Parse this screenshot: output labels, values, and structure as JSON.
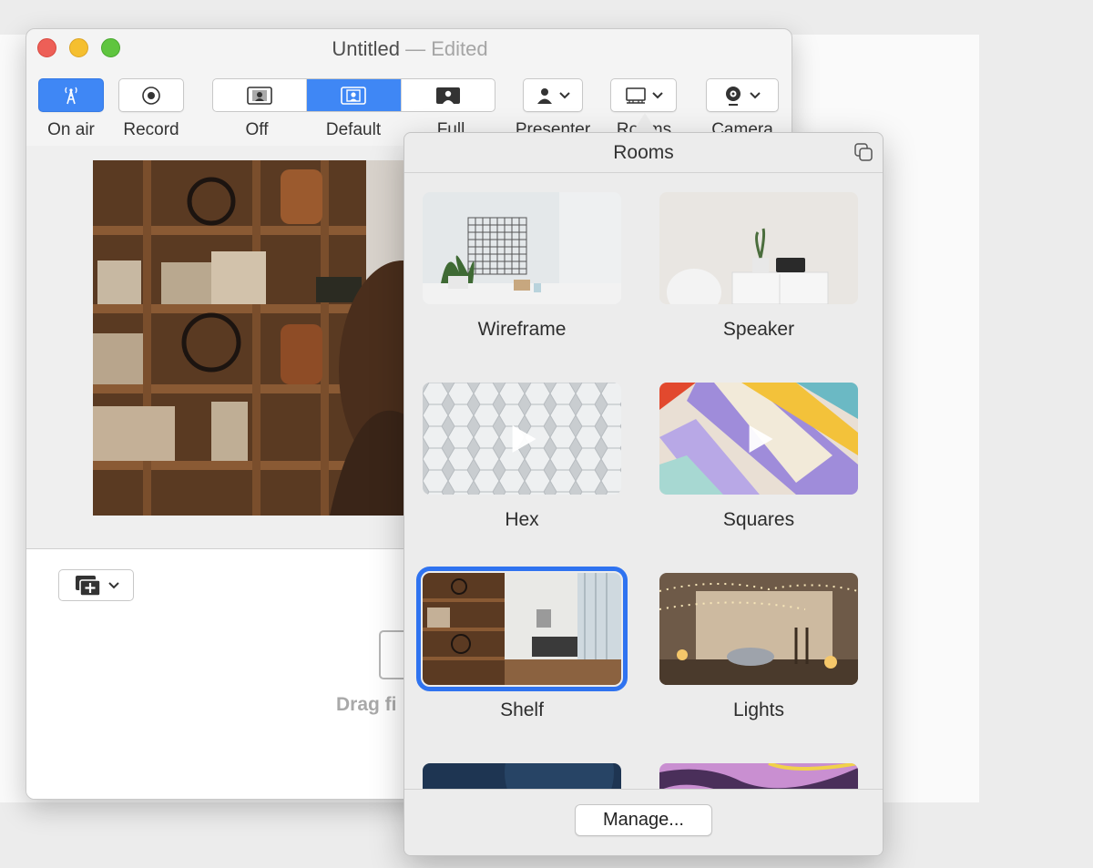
{
  "window": {
    "title": "Untitled",
    "title_suffix": " — Edited"
  },
  "toolbar": {
    "on_air": "On air",
    "record": "Record",
    "layout_off": "Off",
    "layout_default": "Default",
    "layout_full": "Full",
    "presenter": "Presenter",
    "rooms": "Rooms",
    "camera": "Camera"
  },
  "stage": {
    "drop_hint": "Drag fi"
  },
  "rooms_popover": {
    "title": "Rooms",
    "rooms": [
      {
        "name": "Wireframe",
        "video": false,
        "selected": false
      },
      {
        "name": "Speaker",
        "video": false,
        "selected": false
      },
      {
        "name": "Hex",
        "video": true,
        "selected": false
      },
      {
        "name": "Squares",
        "video": true,
        "selected": false
      },
      {
        "name": "Shelf",
        "video": false,
        "selected": true
      },
      {
        "name": "Lights",
        "video": false,
        "selected": false
      }
    ],
    "manage_label": "Manage..."
  },
  "colors": {
    "accent": "#3f87f5",
    "selection": "#2f73f0"
  },
  "icons": [
    "on-air-tower-icon",
    "record-icon",
    "layout-off-icon",
    "layout-default-icon",
    "layout-full-icon",
    "presenter-icon",
    "rooms-icon",
    "camera-icon",
    "add-slide-icon",
    "detach-icon",
    "play-icon"
  ]
}
